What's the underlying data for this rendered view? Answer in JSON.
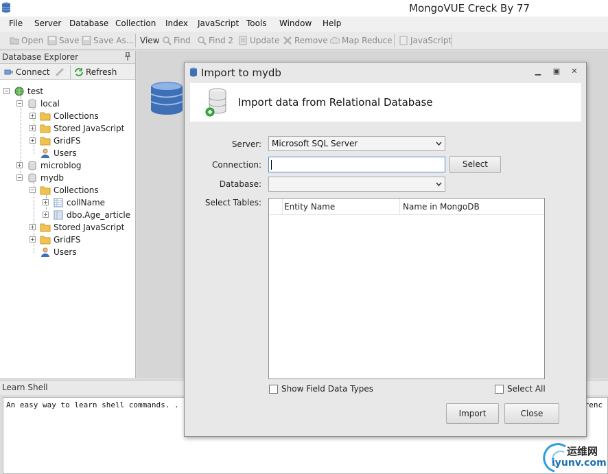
{
  "window": {
    "title": "MongoVUE Creck By 77"
  },
  "menu": [
    "File",
    "Server",
    "Database",
    "Collection",
    "Index",
    "JavaScript",
    "Tools",
    "Window",
    "Help"
  ],
  "toolbar": {
    "open": "Open",
    "save": "Save",
    "save_as": "Save As...",
    "view": "View",
    "find": "Find",
    "find2": "Find 2",
    "update": "Update",
    "remove": "Remove",
    "map_reduce": "Map Reduce",
    "javascript": "JavaScript"
  },
  "explorer": {
    "title": "Database Explorer",
    "connect": "Connect",
    "refresh": "Refresh",
    "tree": {
      "server": "test",
      "local": "local",
      "local_collections": "Collections",
      "local_js": "Stored JavaScript",
      "local_gridfs": "GridFS",
      "local_users": "Users",
      "microblog": "microblog",
      "mydb": "mydb",
      "mydb_collections": "Collections",
      "coll1": "collName",
      "coll2": "dbo.Age_article",
      "mydb_js": "Stored JavaScript",
      "mydb_gridfs": "GridFS",
      "mydb_users": "Users"
    }
  },
  "learn_shell": {
    "title": "Learn Shell",
    "text": "An easy way to learn shell commands. .",
    "tail": "erenc"
  },
  "dialog": {
    "title": "Import to mydb",
    "header": "Import data from Relational Database",
    "server_label": "Server:",
    "server_value": "Microsoft SQL Server",
    "connection_label": "Connection:",
    "connection_value": "",
    "select_button": "Select",
    "database_label": "Database:",
    "database_value": "",
    "tables_label": "Select Tables:",
    "columns": [
      "Entity Name",
      "Name in MongoDB"
    ],
    "show_types": "Show Field Data Types",
    "select_all": "Select All",
    "import_button": "Import",
    "close_button": "Close"
  },
  "watermark": {
    "cn": "运维网",
    "en": "iyunv.com"
  },
  "colors": {
    "accent": "#4e8fd8",
    "folder": "#f2c24f",
    "db": "#3f6fb4"
  }
}
